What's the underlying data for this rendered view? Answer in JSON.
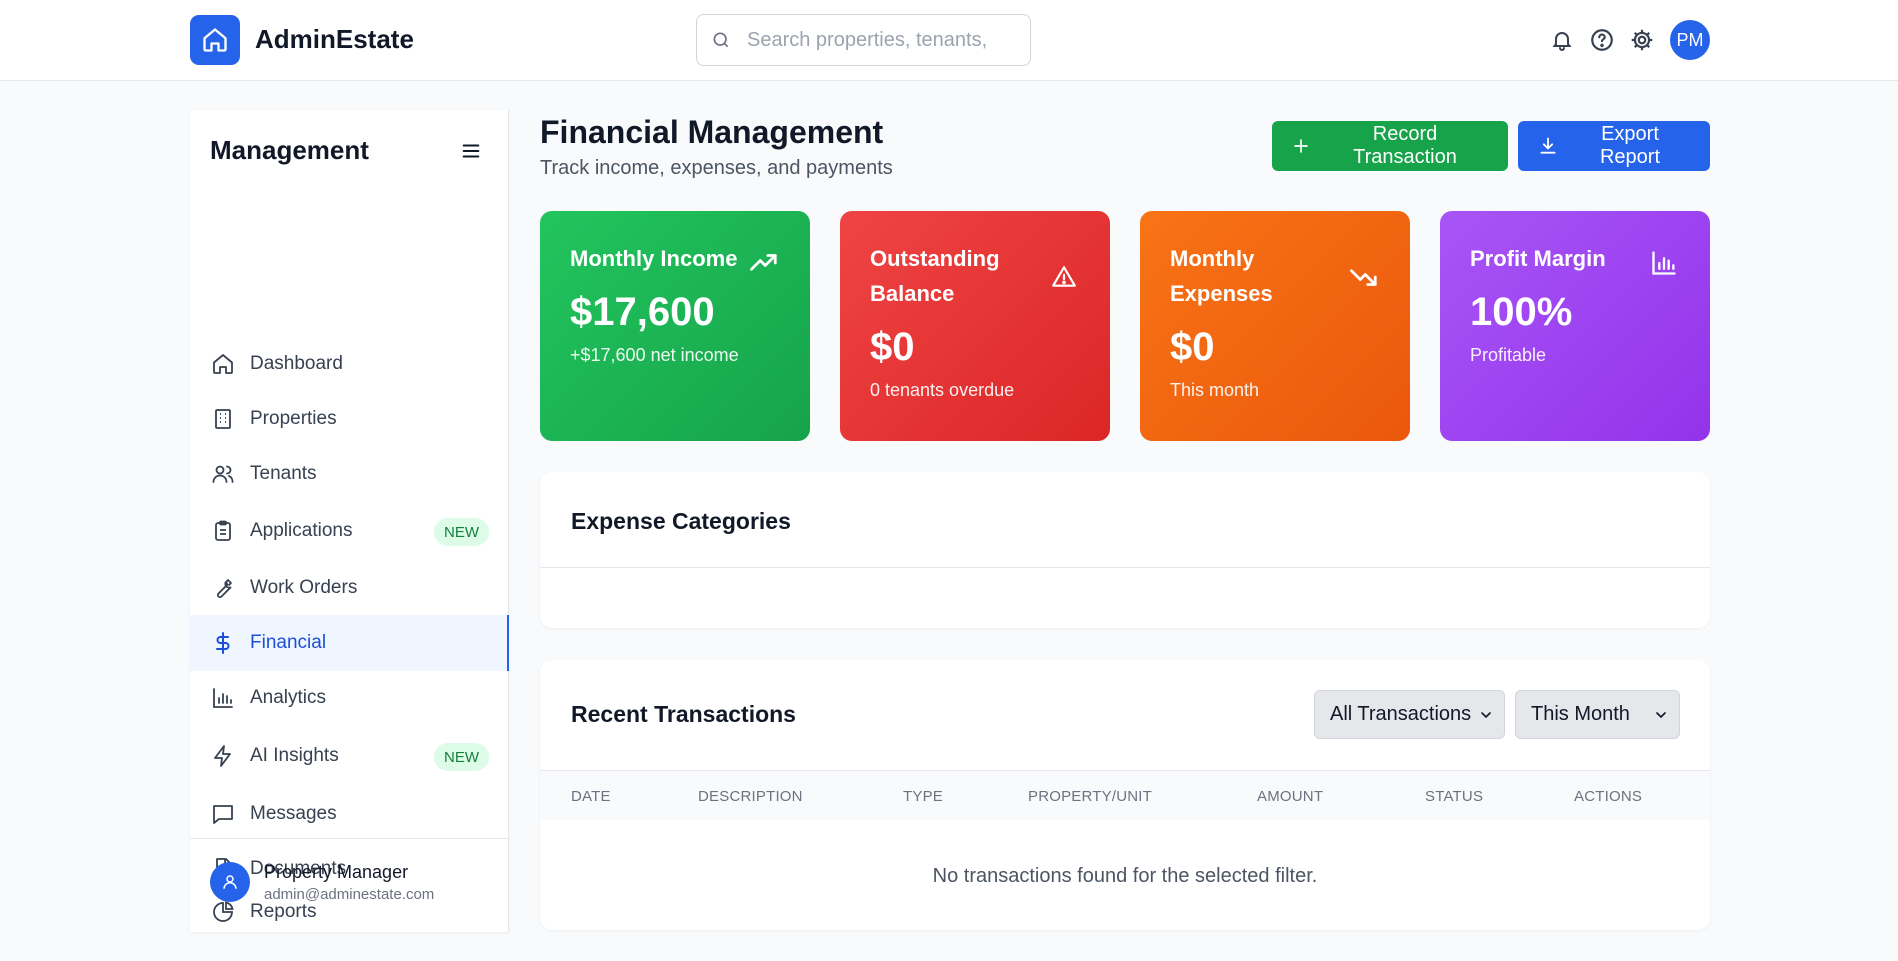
{
  "app": {
    "name": "AdminEstate",
    "search_placeholder": "Search properties, tenants,",
    "user_initials": "PM"
  },
  "sidebar": {
    "title": "Management",
    "items": [
      {
        "label": "Dashboard",
        "icon": "home-icon"
      },
      {
        "label": "Properties",
        "icon": "building-icon"
      },
      {
        "label": "Tenants",
        "icon": "users-icon"
      },
      {
        "label": "Applications",
        "icon": "clipboard-icon",
        "badge": "NEW"
      },
      {
        "label": "Work Orders",
        "icon": "wrench-icon"
      },
      {
        "label": "Financial",
        "icon": "dollar-icon",
        "active": true
      },
      {
        "label": "Analytics",
        "icon": "bar-chart-icon"
      },
      {
        "label": "AI Insights",
        "icon": "lightning-icon",
        "badge": "NEW"
      },
      {
        "label": "Messages",
        "icon": "message-icon"
      },
      {
        "label": "Documents",
        "icon": "document-icon"
      },
      {
        "label": "Reports",
        "icon": "pie-chart-icon"
      }
    ],
    "user": {
      "name": "Property Manager",
      "email": "admin@adminestate.com"
    }
  },
  "header": {
    "title": "Financial Management",
    "subtitle": "Track income, expenses, and payments",
    "record_button": "Record Transaction",
    "export_button": "Export Report"
  },
  "stats": [
    {
      "label": "Monthly Income",
      "value": "$17,600",
      "note": "+$17,600 net income",
      "icon": "trending-up-icon",
      "color": "#16a34a"
    },
    {
      "label": "Outstanding Balance",
      "value": "$0",
      "note": "0 tenants overdue",
      "icon": "warning-icon",
      "color": "#dc2626"
    },
    {
      "label": "Monthly Expenses",
      "value": "$0",
      "note": "This month",
      "icon": "trending-down-icon",
      "color": "#ea580c"
    },
    {
      "label": "Profit Margin",
      "value": "100%",
      "note": "Profitable",
      "icon": "bar-chart-icon",
      "color": "#9333ea"
    }
  ],
  "expense_categories": {
    "title": "Expense Categories"
  },
  "transactions": {
    "title": "Recent Transactions",
    "filter_type": "All Transactions",
    "filter_period": "This Month",
    "columns": [
      "DATE",
      "DESCRIPTION",
      "TYPE",
      "PROPERTY/UNIT",
      "AMOUNT",
      "STATUS",
      "ACTIONS"
    ],
    "empty_message": "No transactions found for the selected filter."
  }
}
